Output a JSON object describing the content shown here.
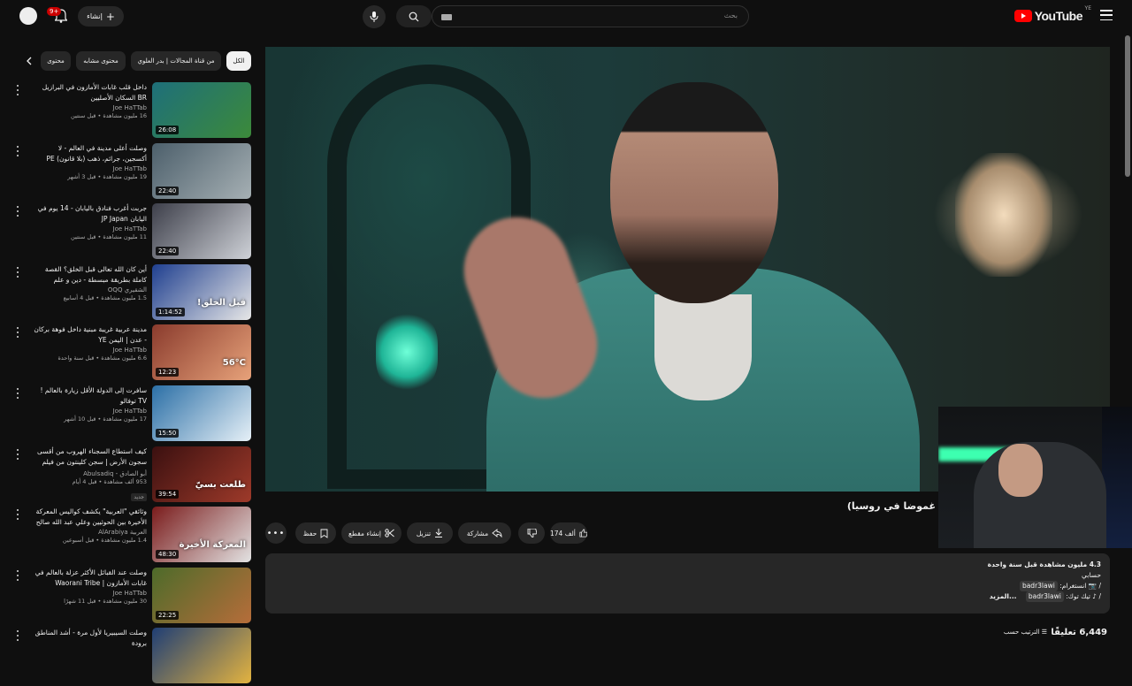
{
  "topbar": {
    "logo_text": "YouTube",
    "logo_country": "YE",
    "search_placeholder": "بحث",
    "create_label": "إنشاء",
    "notification_count": "9+"
  },
  "chips": [
    {
      "label": "الكل",
      "active": true
    },
    {
      "label": "من قناة المجالات | بدر العلوي",
      "active": false
    },
    {
      "label": "محتوى مشابه",
      "active": false
    },
    {
      "label": "محتوى",
      "active": false
    }
  ],
  "recommendations": [
    {
      "title": "داخل قلب غابات الأمازون في البرازيل BR السكان الأصليين",
      "channel": "Joe HaTTab",
      "meta": "16 مليون مشاهدة • قبل سنتين",
      "duration": "26:08",
      "colors": [
        "#1e6f7a",
        "#3c8a3a"
      ]
    },
    {
      "title": "وصلت أعلى مدينة في العالم - لا أكسجين، جرائم، ذهب (بلا قانون) PE",
      "channel": "Joe HaTTab",
      "meta": "19 مليون مشاهدة • قبل 3 أشهر",
      "duration": "22:40",
      "colors": [
        "#4c5f6b",
        "#a6b0b4"
      ]
    },
    {
      "title": "جربت أغرب فنادق باليابان - 14 يوم في اليابان JP Japan",
      "channel": "Joe HaTTab",
      "meta": "11 مليون مشاهدة • قبل سنتين",
      "duration": "22:40",
      "colors": [
        "#3d3f4a",
        "#cfd2d8"
      ]
    },
    {
      "title": "أين كان الله تعالى قبل الخلق؟ القصة كاملة بطريقة مبسطة - دين و علم",
      "channel": "الشقيري OQQ",
      "meta": "1.5 مليون مشاهدة • قبل 4 أسابيع",
      "duration": "1:14:52",
      "colors": [
        "#1f3f8f",
        "#e7e7e7"
      ],
      "overlay": "قبل الخلق!"
    },
    {
      "title": "مدينة عربية غريبة مبنية داخل فوهة بركان - عدن | اليمن YE",
      "channel": "Joe HaTTab",
      "meta": "6.6 مليون مشاهدة • قبل سنة واحدة",
      "duration": "12:23",
      "colors": [
        "#8a3b2d",
        "#e7a27a"
      ],
      "overlay": "56°C"
    },
    {
      "title": "سافرت إلى الدولة الأقل زيارة بالعالم ! TV توفالو",
      "channel": "Joe HaTTab",
      "meta": "17 مليون مشاهدة • قبل 10 أشهر",
      "duration": "15:50",
      "colors": [
        "#2b6fa6",
        "#e6f0f7"
      ]
    },
    {
      "title": "كيف استطاع السجناء الهروب من أقسى سجون الأرض | سجن كلينتون من فيلم إلى حقيقة",
      "channel": "أبو الصادق - Abulsadiq",
      "meta": "953 ألف مشاهدة • قبل 4 أيام",
      "badge": "جديد",
      "duration": "39:54",
      "colors": [
        "#3b1010",
        "#9e3a2a"
      ],
      "overlay": "طلعت بسيّ"
    },
    {
      "title": "وثائقي \"العربية\" يكشف كواليس المعركة الأخيرة بين الحوثيين وعلي عبد الله صالح",
      "channel": "العربية AlArabiya",
      "meta": "1.4 مليون مشاهدة • قبل أسبوعين",
      "duration": "48:30",
      "colors": [
        "#7a1b1b",
        "#e3e3e3"
      ],
      "overlay": "المعركة الأخيرة"
    },
    {
      "title": "وصلت عند القبائل الأكثر عزلة بالعالم في غابات الأمازون | Waorani Tribe",
      "channel": "Joe HaTTab",
      "meta": "30 مليون مشاهدة • قبل 11 شهرًا",
      "duration": "22:25",
      "colors": [
        "#4d6b2a",
        "#b66d3a"
      ]
    },
    {
      "title": "وصلت السيبيريا لأول مرة - أشد المناطق برودة",
      "channel": "",
      "meta": "",
      "duration": "",
      "colors": [
        "#1f3e75",
        "#e3b340"
      ]
    }
  ],
  "video": {
    "title": "غموضا في روسيا)",
    "likes": "174 ألف",
    "share_label": "مشاركة",
    "download_label": "تنزيل",
    "clip_label": "إنشاء مقطع",
    "save_label": "حفظ"
  },
  "description": {
    "stats": "4.3 مليون مشاهدة  قبل سنة واحدة",
    "line2": "حسابي",
    "handle1": "badr3lawi",
    "handle1_suffix": "/ 📷 انستغرام:",
    "handle2": "badr3lawi",
    "handle2_suffix": "/ ♪ تيك توك:",
    "more": "...المزيد"
  },
  "comments": {
    "count": "6,449 تعليقًا",
    "sort_label": "الترتيب حسب"
  }
}
